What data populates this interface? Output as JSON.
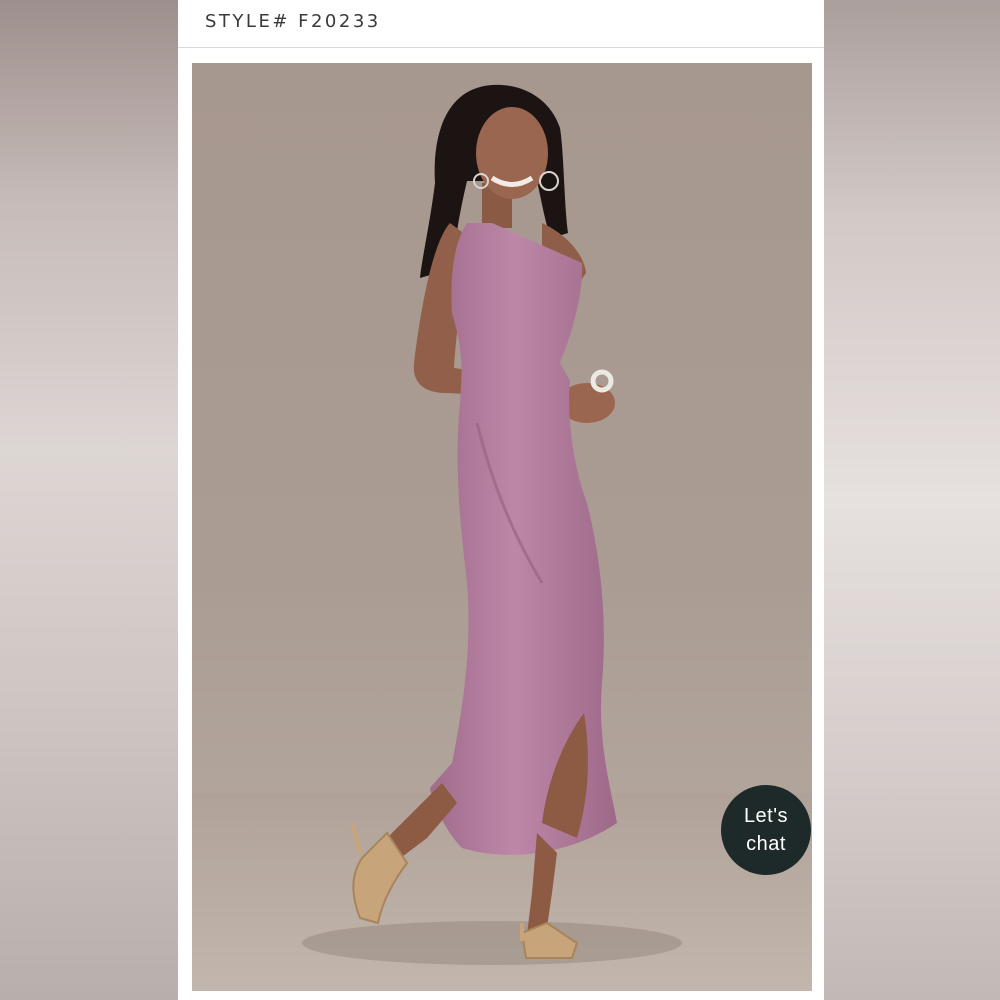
{
  "header": {
    "style_label": "STYLE# F20233"
  },
  "product": {
    "image_subject": "model wearing one-shoulder dusty rose crepe maxi dress with tulip hem and gold strappy heels",
    "dress_color": "#b07a9c",
    "backdrop_color": "#a99a91"
  },
  "chat": {
    "label": "Let's\nchat"
  }
}
